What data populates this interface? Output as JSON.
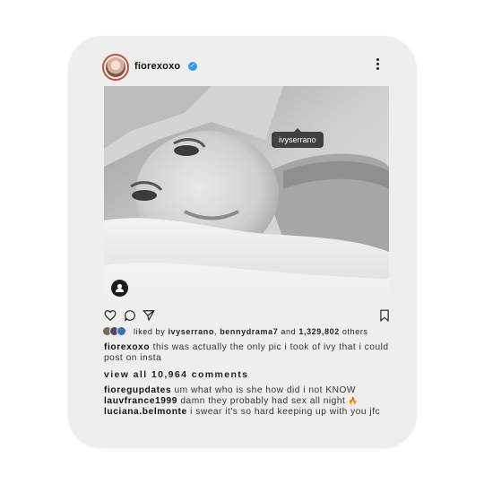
{
  "post": {
    "username": "fiorexoxo",
    "verified_icon": "verified-badge-icon",
    "more_icon": "more-options-icon",
    "photo_tag": "ivyserrano",
    "action_icons": [
      "heart-icon",
      "comment-icon",
      "share-icon",
      "bookmark-icon"
    ],
    "likes": {
      "prefix": "liked by",
      "user1": "ivyserrano",
      "sep": ",",
      "user2": "bennydrama7",
      "and": "and",
      "count": "1,329,802",
      "suffix": "others"
    },
    "caption": {
      "user": "fiorexoxo",
      "text": "this was actually the only pic i took of ivy that i could post on insta"
    },
    "view_all": "view all 10,964 comments",
    "comments": [
      {
        "user": "fioregupdates",
        "text": "um what who is she how did i not KNOW"
      },
      {
        "user": "lauvfrance1999",
        "text": "damn they probably had sex all night",
        "emoji": "🔥"
      },
      {
        "user": "luciana.belmonte",
        "text": "i swear it's so hard keeping up with you jfc"
      }
    ]
  },
  "colors": {
    "card_bg": "#eeeeec",
    "verified": "#3897f0",
    "avatar_ring": "#c94d3c"
  }
}
